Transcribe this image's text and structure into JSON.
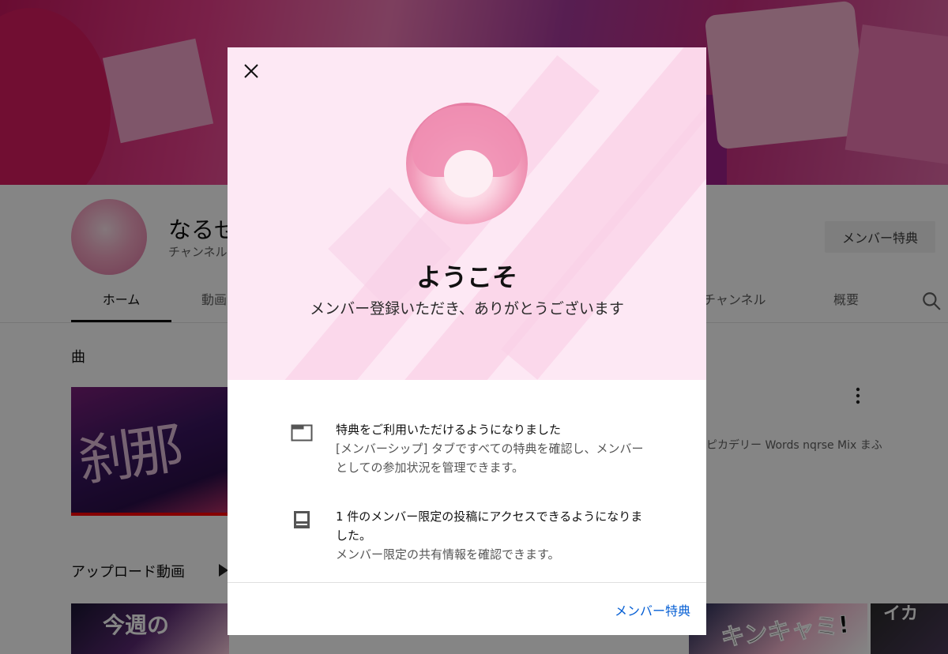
{
  "channel": {
    "name": "なるせ",
    "subtitle": "チャンネル",
    "perks_button": "メンバー特典"
  },
  "nav": {
    "tabs": [
      "ホーム",
      "動画",
      "チャンネル",
      "概要"
    ],
    "search_icon": "search-icon"
  },
  "sections": {
    "songs_title": "曲",
    "song_thumbnail_text": "刹那",
    "song_meta": "ピカデリー Words nqrse Mix まふ",
    "uploads_title": "アップロード動画",
    "upload_thumb_1": "今週の",
    "upload_thumb_2": "キンキャミ!",
    "upload_thumb_3": "イカ"
  },
  "dialog": {
    "close_icon": "close-icon",
    "title": "ようこそ",
    "subtitle": "メンバー登録いただき、ありがとうございます",
    "perks": [
      {
        "icon": "membership-tab-icon",
        "title": "特典をご利用いただけるようになりました",
        "description": "[メンバーシップ] タブですべての特典を確認し、メンバーとしての参加状況を管理できます。"
      },
      {
        "icon": "community-post-icon",
        "title": "1 件のメンバー限定の投稿にアクセスできるようになりました。",
        "description": "メンバー限定の共有情報を確認できます。"
      }
    ],
    "link_label": "メンバー特典"
  },
  "colors": {
    "header_pink": "#fde8f4",
    "link_blue": "#065fd4",
    "scrim": "rgba(0,0,0,0.48)"
  }
}
